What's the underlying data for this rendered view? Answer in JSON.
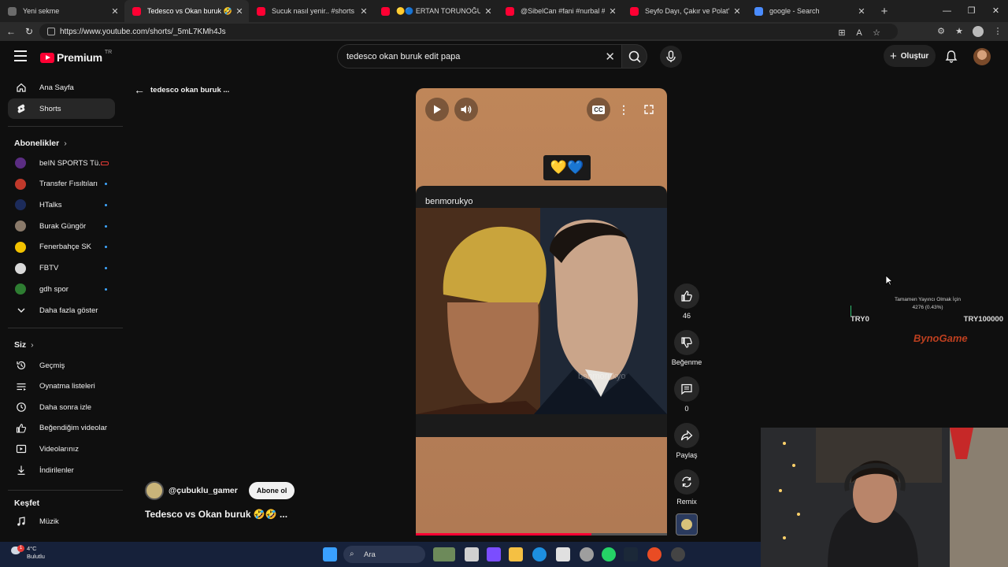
{
  "browser": {
    "tabs": [
      {
        "title": "Yeni sekme",
        "fav": "#6b6b6b"
      },
      {
        "title": "Tedesco vs Okan buruk 🤣🤣 ...",
        "fav": "#ff0033"
      },
      {
        "title": "Sucuk nasıl yenir.. #shorts - YouTu",
        "fav": "#ff0033"
      },
      {
        "title": "🟡🔵 ERTAN TORUNOĞULLARI'N",
        "fav": "#ff0033"
      },
      {
        "title": "@SibelCan #fani #nurbal #cover #",
        "fav": "#ff0033"
      },
      {
        "title": "Seyfo Dayı, Çakır ve Polat'a Alemi",
        "fav": "#ff0033"
      },
      {
        "title": "google - Search",
        "fav": "#4a8cff"
      }
    ],
    "url": "https://www.youtube.com/shorts/_5mL7KMh4Js",
    "icons": [
      "back-icon",
      "reload-icon",
      "lock-icon",
      "star-icon",
      "extensions-icon",
      "profile-icon",
      "menu-icon"
    ]
  },
  "header": {
    "logo_text": "Premium",
    "logo_region": "TR",
    "search_query": "tedesco okan buruk edit papa",
    "create_label": "Oluştur"
  },
  "sidebar": {
    "main": [
      {
        "label": "Ana Sayfa",
        "icon": "home-icon"
      },
      {
        "label": "Shorts",
        "icon": "shorts-icon"
      }
    ],
    "subs_title": "Abonelikler",
    "subs": [
      {
        "label": "beIN SPORTS Tü...",
        "color": "#5b2d82"
      },
      {
        "label": "Transfer Fısıltıları",
        "color": "#c0392b"
      },
      {
        "label": "HTalks",
        "color": "#1c2b5a"
      },
      {
        "label": "Burak Güngör",
        "color": "#8a7a6a"
      },
      {
        "label": "Fenerbahçe SK",
        "color": "#f2c200"
      },
      {
        "label": "FBTV",
        "color": "#d9d9d9"
      },
      {
        "label": "gdh spor",
        "color": "#2e7d32"
      }
    ],
    "more_label": "Daha fazla göster",
    "you_title": "Siz",
    "you": [
      {
        "label": "Geçmiş",
        "icon": "history-icon"
      },
      {
        "label": "Oynatma listeleri",
        "icon": "playlist-icon"
      },
      {
        "label": "Daha sonra izle",
        "icon": "clock-icon"
      },
      {
        "label": "Beğendiğim videolar",
        "icon": "like-icon"
      },
      {
        "label": "Videolarınız",
        "icon": "video-icon"
      },
      {
        "label": "İndirilenler",
        "icon": "download-icon"
      }
    ],
    "explore_title": "Keşfet",
    "explore": [
      {
        "label": "Müzik",
        "icon": "music-icon"
      }
    ]
  },
  "shorts": {
    "back_label": "tedesco okan buruk ...",
    "hearts": "💛💙",
    "clip_user": "benmorukyo",
    "watermark": "benmorukyo",
    "progress": 0.7,
    "actions": {
      "likes": "46",
      "dislike_label": "Beğenme",
      "comments": "0",
      "share_label": "Paylaş",
      "remix_label": "Remix"
    },
    "channel": "@çubuklu_gamer",
    "subscribe_label": "Abone ol",
    "title": "Tedesco vs Okan buruk 🤣🤣 ..."
  },
  "overlay": {
    "donation_msg1": "Tamamen Yayıncı Olmak İçin",
    "donation_msg2": "4276 (0.43%)",
    "donation_progress": 0.0043,
    "min": "TRY0",
    "max": "TRY100000",
    "brand": "BynoGame"
  },
  "taskbar": {
    "temp": "4°C",
    "weather": "Bulutlu",
    "search_label": "Ara",
    "notif_count": "1"
  }
}
